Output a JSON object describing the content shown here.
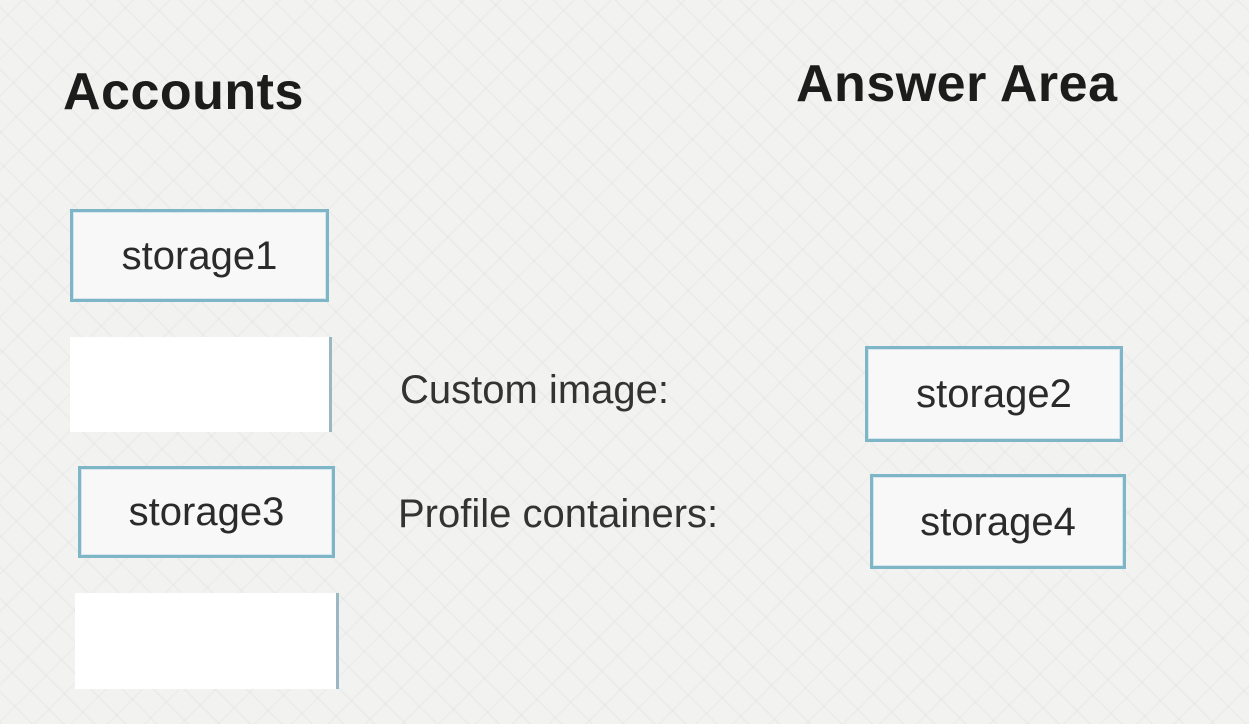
{
  "headings": {
    "accounts": "Accounts",
    "answer_area": "Answer Area"
  },
  "accounts": {
    "items": [
      {
        "label": "storage1"
      },
      {
        "label": ""
      },
      {
        "label": "storage3"
      },
      {
        "label": ""
      }
    ]
  },
  "answer_area": {
    "rows": [
      {
        "label": "Custom image:",
        "value": "storage2"
      },
      {
        "label": "Profile containers:",
        "value": "storage4"
      }
    ]
  },
  "colors": {
    "tile_border": "#7fb6c7",
    "background": "#f2f2f0"
  }
}
